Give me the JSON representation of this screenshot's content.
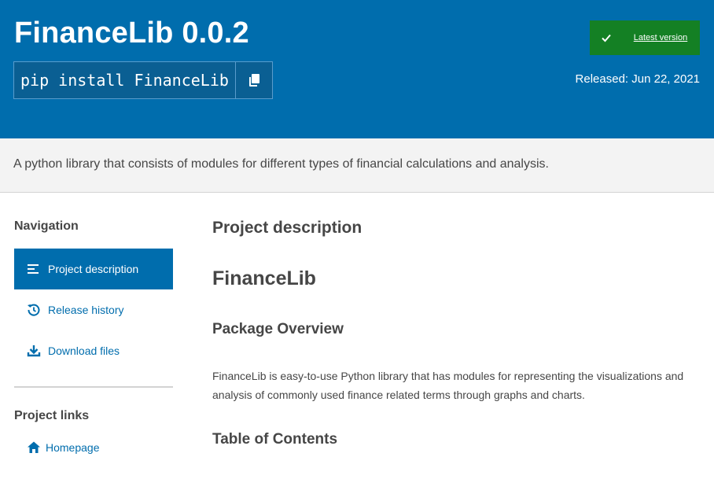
{
  "header": {
    "title": "FinanceLib 0.0.2",
    "pip_command": "pip install FinanceLib",
    "copy_icon": "copy-icon",
    "latest_label": "Latest version",
    "released": "Released: Jun 22, 2021",
    "colors": {
      "banner": "#006dad",
      "latest": "#148024"
    }
  },
  "summary": "A python library that consists of modules for different types of financial calculations and analysis.",
  "sidebar": {
    "navigation_heading": "Navigation",
    "nav_items": [
      {
        "label": "Project description",
        "icon": "align-left-icon",
        "active": true
      },
      {
        "label": "Release history",
        "icon": "history-icon",
        "active": false
      },
      {
        "label": "Download files",
        "icon": "download-icon",
        "active": false
      }
    ],
    "links_heading": "Project links",
    "links": [
      {
        "label": "Homepage",
        "icon": "home-icon"
      }
    ]
  },
  "main": {
    "section_title": "Project description",
    "h1": "FinanceLib",
    "h2_overview": "Package Overview",
    "overview_text": "FinanceLib is easy-to-use Python library that has modules for representing the visualizations and analysis of commonly used finance related terms through graphs and charts.",
    "h2_toc": "Table of Contents"
  }
}
